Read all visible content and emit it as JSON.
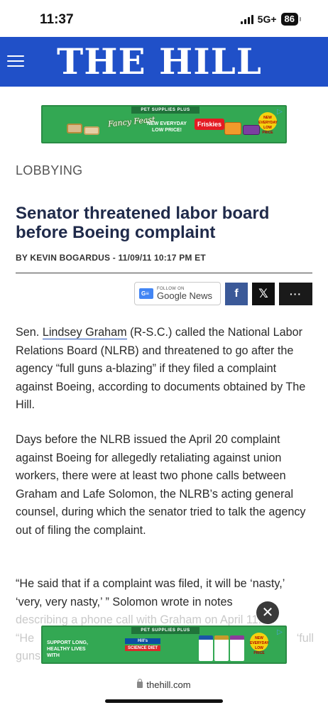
{
  "status_bar": {
    "time": "11:37",
    "network": "5G+",
    "battery": "86"
  },
  "header": {
    "logo": "THE HILL",
    "menu_icon": "hamburger-menu-icon"
  },
  "ad_top": {
    "strip": "PET SUPPLIES PLUS",
    "brand_1": "Fancy Feast",
    "headline": "NEW EVERYDAY LOW PRICE!",
    "brand_2": "Friskies",
    "badge": "NEW EVERYDAY LOW PRICE"
  },
  "article": {
    "section": "LOBBYING",
    "headline": "Senator threatened labor board before Boeing complaint",
    "byline": "BY KEVIN BOGARDUS - 11/09/11 10:17 PM ET",
    "share": {
      "gnews_small": "FOLLOW ON",
      "gnews_big": "Google News",
      "facebook": "f",
      "x": "𝕏",
      "more": "···"
    },
    "p1_before": "Sen. ",
    "p1_link": "Lindsey Graham",
    "p1_after": " (R-S.C.) called the National Labor Relations Board (NLRB) and threatened to go after the agency “full guns a-blazing” if they filed a complaint against Boeing, according to documents obtained by The Hill.",
    "p2": "Days before the NLRB issued the April 20 complaint against Boeing for allegedly retaliating against union workers, there were at least two phone calls between Graham and Lafe Solomon, the NLRB’s acting general counsel, during which the senator tried to talk the agency out of filing the complaint.",
    "p3_visible": "“He said that if a complaint was filed, it will be ‘nasty,’ ‘very, very nasty,’ ” Solomon wrote in notes",
    "p3_faded_1": "describing a phone call with Graham on April 11.",
    "p3_faded_2_left": "“He",
    "p3_faded_2_right": "‘full",
    "p3_faded_3": "guns"
  },
  "ad_bottom": {
    "strip": "PET SUPPLIES PLUS",
    "headline": "SUPPORT LONG, HEALTHY LIVES WITH",
    "brand": "Hill's",
    "brand_sub": "SCIENCE DIET",
    "badge": "NEW EVERYDAY LOW PRICE"
  },
  "close_ad": "✕",
  "url_bar": {
    "url": "thehill.com"
  }
}
